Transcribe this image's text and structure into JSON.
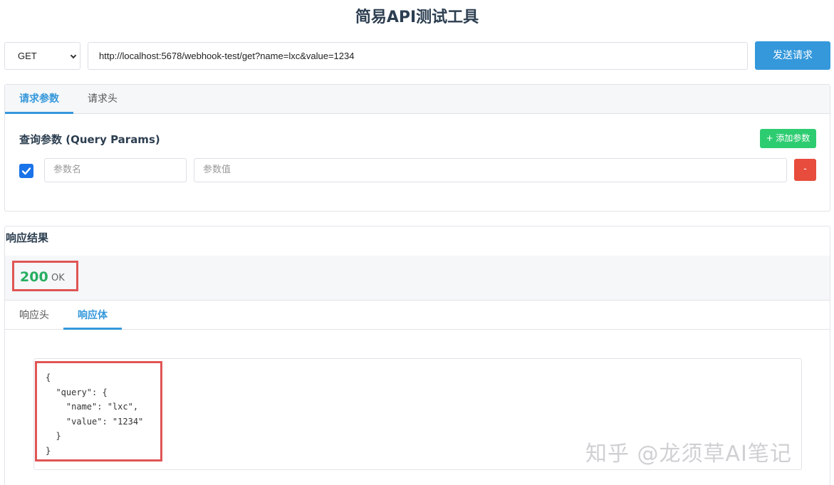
{
  "app": {
    "title": "简易API测试工具"
  },
  "request": {
    "method": "GET",
    "url": "http://localhost:5678/webhook-test/get?name=lxc&value=1234",
    "send_label": "发送请求"
  },
  "request_tabs": [
    {
      "label": "请求参数",
      "active": true
    },
    {
      "label": "请求头",
      "active": false
    }
  ],
  "query_params": {
    "title": "查询参数 (Query Params)",
    "add_label": "+ 添加参数",
    "remove_label": "-",
    "rows": [
      {
        "enabled": true,
        "name_placeholder": "参数名",
        "value_placeholder": "参数值"
      }
    ]
  },
  "response": {
    "title": "响应结果",
    "status_code": "200",
    "status_text": "OK",
    "tabs": [
      {
        "label": "响应头",
        "active": false
      },
      {
        "label": "响应体",
        "active": true
      }
    ],
    "body": "{\n  \"query\": {\n    \"name\": \"lxc\",\n    \"value\": \"1234\"\n  }\n}"
  },
  "watermark": "知乎 @龙须草AI笔记",
  "colors": {
    "primary": "#3498db",
    "success": "#2ecc71",
    "danger": "#e74c3c",
    "status_ok": "#27ae60",
    "highlight": "#e05555"
  }
}
